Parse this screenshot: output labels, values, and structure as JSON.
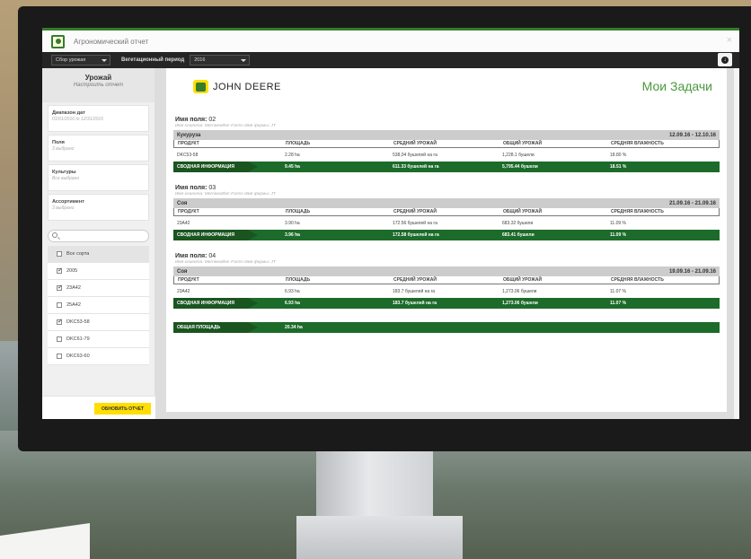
{
  "window": {
    "title": "Агрономический отчет",
    "close": "×"
  },
  "toolbar": {
    "report_type": "Сбор урожая",
    "season_label": "Вегетационный период",
    "season_value": "2016"
  },
  "sidebar": {
    "title": "Урожай",
    "subtitle": "Настроить отчет",
    "cards": [
      {
        "label": "Диапазон дат",
        "value": "01/01/2016 to 12/31/2016"
      },
      {
        "label": "Поля",
        "value": "3 выбрано"
      },
      {
        "label": "Культуры",
        "value": "Все выбрано"
      },
      {
        "label": "Ассортимент",
        "value": "3 выбрано"
      }
    ],
    "varieties": [
      {
        "label": "Все сорта",
        "checked": false
      },
      {
        "label": "2005",
        "checked": true
      },
      {
        "label": "23A42",
        "checked": true
      },
      {
        "label": "25A42",
        "checked": false
      },
      {
        "label": "DKC53-58",
        "checked": true
      },
      {
        "label": "DKC61-79",
        "checked": false
      },
      {
        "label": "DKC63-60",
        "checked": false
      }
    ],
    "update_button": "ОБНОВИТЬ ОТЧЕТ"
  },
  "report": {
    "brand": "JOHN DEERE",
    "heading": "Мои Задачи",
    "field_label": "Имя поля:",
    "columns": [
      "ПРОДУКТ",
      "ПЛОЩАДЬ",
      "СРЕДНИЙ УРОЖАЙ",
      "ОБЩИЙ УРОЖАЙ",
      "СРЕДНЯЯ ВЛАЖНОСТЬ"
    ],
    "fields": [
      {
        "name": "02",
        "sub": "Имя клиента: Merriweather Farms   Имя фермы: JT",
        "crop": "Кукуруза",
        "dates": "12.09.16 - 12.10.16",
        "row": [
          "DKC53-58",
          "2.28 ha",
          "538,04 бушелей на га",
          "1,228.1 бушели",
          "18.80 %"
        ],
        "summary": [
          "СВОДНАЯ ИНФОРМАЦИЯ",
          "9.45 ha",
          "611.33 бушелей на га",
          "5,795.44 бушели",
          "18.51 %"
        ]
      },
      {
        "name": "03",
        "sub": "Имя клиента: Merriweather Farms   Имя фермы: JT",
        "crop": "Соя",
        "dates": "21.09.16 - 21.09.16",
        "row": [
          "23A42",
          "3.90 ha",
          "172.56 бушелей на га",
          "683.32 бушели",
          "11.09 %"
        ],
        "summary": [
          "СВОДНАЯ ИНФОРМАЦИЯ",
          "3.96 ha",
          "172.58 бушелей на га",
          "683.41 бушели",
          "11.09 %"
        ]
      },
      {
        "name": "04",
        "sub": "Имя клиента: Merriweather Farms   Имя фермы: JT",
        "crop": "Соя",
        "dates": "19.09.16 - 21.09.16",
        "row": [
          "23A42",
          "6.93 ha",
          "183.7 бушелей на га",
          "1,273.06 бушели",
          "11.07 %"
        ],
        "summary": [
          "СВОДНАЯ ИНФОРМАЦИЯ",
          "6.93 ha",
          "183.7 бушелей на га",
          "1,273.06 бушели",
          "11.07 %"
        ]
      }
    ],
    "total_label": "ОБЩАЯ ПЛОЩАДЬ",
    "total_value": "20.34 ha"
  }
}
